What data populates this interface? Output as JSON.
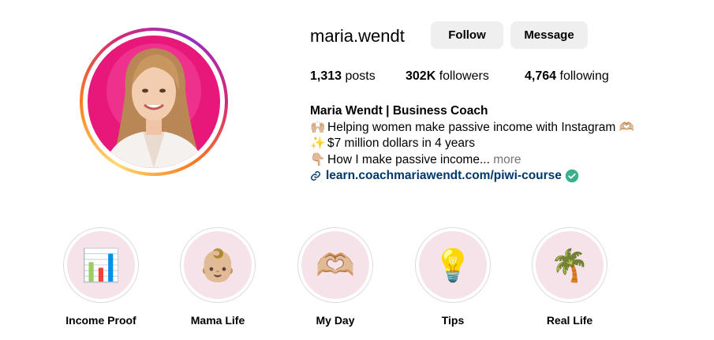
{
  "profile": {
    "username": "maria.wendt",
    "follow_label": "Follow",
    "message_label": "Message"
  },
  "stats": {
    "posts_count": "1,313",
    "posts_label": "posts",
    "followers_count": "302K",
    "followers_label": "followers",
    "following_count": "4,764",
    "following_label": "following"
  },
  "bio": {
    "name": "Maria Wendt | Business Coach",
    "line1": "Helping women make passive income with Instagram",
    "line2": "$7 million dollars in 4 years",
    "line3": "How I make passive income...",
    "more": "more",
    "link": "learn.coachmariawendt.com/piwi-course"
  },
  "highlights": [
    {
      "label": "Income Proof",
      "emoji": "📊"
    },
    {
      "label": "Mama Life",
      "emoji": "👶🏼"
    },
    {
      "label": "My Day",
      "emoji": "🫶🏼"
    },
    {
      "label": "Tips",
      "emoji": "💡"
    },
    {
      "label": "Real Life",
      "emoji": "🌴"
    }
  ],
  "colors": {
    "button_bg": "#efefef",
    "link": "#00376b",
    "verified": "#3bb08f",
    "highlight_bg": "#f6e3ea",
    "avatar_bg": "#e8187a"
  },
  "icons": {
    "bio_line1": "raising-hands-icon",
    "bio_line2": "sparkles-icon",
    "bio_line3": "pointing-down-icon",
    "link": "link-icon",
    "verified": "verified-check-icon"
  }
}
